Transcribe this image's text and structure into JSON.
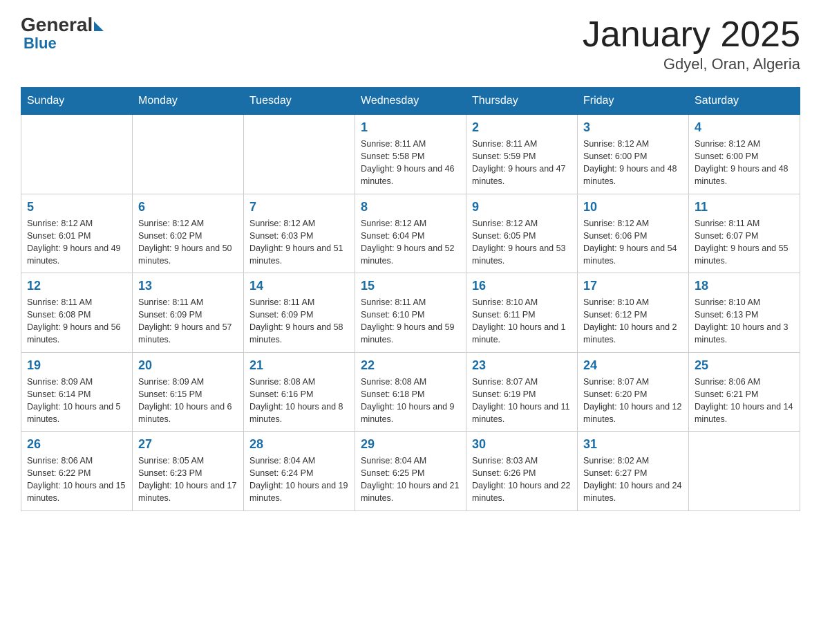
{
  "header": {
    "logo_general": "General",
    "logo_blue": "Blue",
    "month_title": "January 2025",
    "location": "Gdyel, Oran, Algeria"
  },
  "days_of_week": [
    "Sunday",
    "Monday",
    "Tuesday",
    "Wednesday",
    "Thursday",
    "Friday",
    "Saturday"
  ],
  "weeks": [
    [
      {
        "day": "",
        "info": ""
      },
      {
        "day": "",
        "info": ""
      },
      {
        "day": "",
        "info": ""
      },
      {
        "day": "1",
        "info": "Sunrise: 8:11 AM\nSunset: 5:58 PM\nDaylight: 9 hours and 46 minutes."
      },
      {
        "day": "2",
        "info": "Sunrise: 8:11 AM\nSunset: 5:59 PM\nDaylight: 9 hours and 47 minutes."
      },
      {
        "day": "3",
        "info": "Sunrise: 8:12 AM\nSunset: 6:00 PM\nDaylight: 9 hours and 48 minutes."
      },
      {
        "day": "4",
        "info": "Sunrise: 8:12 AM\nSunset: 6:00 PM\nDaylight: 9 hours and 48 minutes."
      }
    ],
    [
      {
        "day": "5",
        "info": "Sunrise: 8:12 AM\nSunset: 6:01 PM\nDaylight: 9 hours and 49 minutes."
      },
      {
        "day": "6",
        "info": "Sunrise: 8:12 AM\nSunset: 6:02 PM\nDaylight: 9 hours and 50 minutes."
      },
      {
        "day": "7",
        "info": "Sunrise: 8:12 AM\nSunset: 6:03 PM\nDaylight: 9 hours and 51 minutes."
      },
      {
        "day": "8",
        "info": "Sunrise: 8:12 AM\nSunset: 6:04 PM\nDaylight: 9 hours and 52 minutes."
      },
      {
        "day": "9",
        "info": "Sunrise: 8:12 AM\nSunset: 6:05 PM\nDaylight: 9 hours and 53 minutes."
      },
      {
        "day": "10",
        "info": "Sunrise: 8:12 AM\nSunset: 6:06 PM\nDaylight: 9 hours and 54 minutes."
      },
      {
        "day": "11",
        "info": "Sunrise: 8:11 AM\nSunset: 6:07 PM\nDaylight: 9 hours and 55 minutes."
      }
    ],
    [
      {
        "day": "12",
        "info": "Sunrise: 8:11 AM\nSunset: 6:08 PM\nDaylight: 9 hours and 56 minutes."
      },
      {
        "day": "13",
        "info": "Sunrise: 8:11 AM\nSunset: 6:09 PM\nDaylight: 9 hours and 57 minutes."
      },
      {
        "day": "14",
        "info": "Sunrise: 8:11 AM\nSunset: 6:09 PM\nDaylight: 9 hours and 58 minutes."
      },
      {
        "day": "15",
        "info": "Sunrise: 8:11 AM\nSunset: 6:10 PM\nDaylight: 9 hours and 59 minutes."
      },
      {
        "day": "16",
        "info": "Sunrise: 8:10 AM\nSunset: 6:11 PM\nDaylight: 10 hours and 1 minute."
      },
      {
        "day": "17",
        "info": "Sunrise: 8:10 AM\nSunset: 6:12 PM\nDaylight: 10 hours and 2 minutes."
      },
      {
        "day": "18",
        "info": "Sunrise: 8:10 AM\nSunset: 6:13 PM\nDaylight: 10 hours and 3 minutes."
      }
    ],
    [
      {
        "day": "19",
        "info": "Sunrise: 8:09 AM\nSunset: 6:14 PM\nDaylight: 10 hours and 5 minutes."
      },
      {
        "day": "20",
        "info": "Sunrise: 8:09 AM\nSunset: 6:15 PM\nDaylight: 10 hours and 6 minutes."
      },
      {
        "day": "21",
        "info": "Sunrise: 8:08 AM\nSunset: 6:16 PM\nDaylight: 10 hours and 8 minutes."
      },
      {
        "day": "22",
        "info": "Sunrise: 8:08 AM\nSunset: 6:18 PM\nDaylight: 10 hours and 9 minutes."
      },
      {
        "day": "23",
        "info": "Sunrise: 8:07 AM\nSunset: 6:19 PM\nDaylight: 10 hours and 11 minutes."
      },
      {
        "day": "24",
        "info": "Sunrise: 8:07 AM\nSunset: 6:20 PM\nDaylight: 10 hours and 12 minutes."
      },
      {
        "day": "25",
        "info": "Sunrise: 8:06 AM\nSunset: 6:21 PM\nDaylight: 10 hours and 14 minutes."
      }
    ],
    [
      {
        "day": "26",
        "info": "Sunrise: 8:06 AM\nSunset: 6:22 PM\nDaylight: 10 hours and 15 minutes."
      },
      {
        "day": "27",
        "info": "Sunrise: 8:05 AM\nSunset: 6:23 PM\nDaylight: 10 hours and 17 minutes."
      },
      {
        "day": "28",
        "info": "Sunrise: 8:04 AM\nSunset: 6:24 PM\nDaylight: 10 hours and 19 minutes."
      },
      {
        "day": "29",
        "info": "Sunrise: 8:04 AM\nSunset: 6:25 PM\nDaylight: 10 hours and 21 minutes."
      },
      {
        "day": "30",
        "info": "Sunrise: 8:03 AM\nSunset: 6:26 PM\nDaylight: 10 hours and 22 minutes."
      },
      {
        "day": "31",
        "info": "Sunrise: 8:02 AM\nSunset: 6:27 PM\nDaylight: 10 hours and 24 minutes."
      },
      {
        "day": "",
        "info": ""
      }
    ]
  ]
}
